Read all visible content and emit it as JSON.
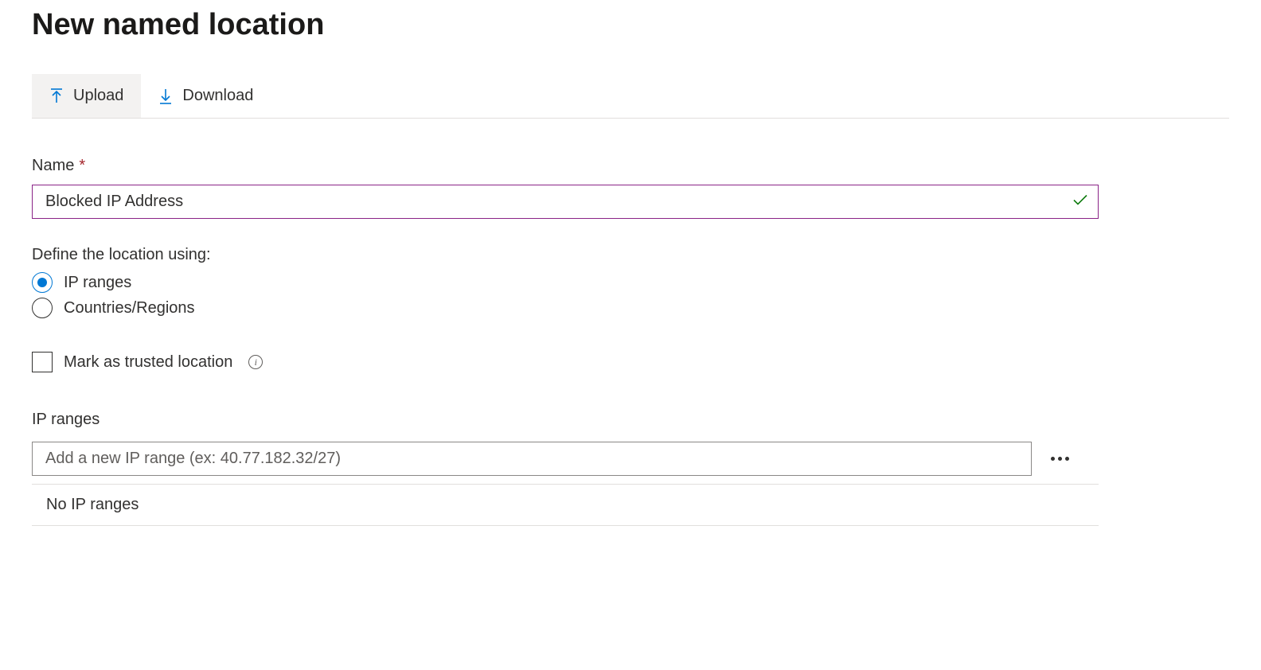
{
  "title": "New named location",
  "toolbar": {
    "upload_label": "Upload",
    "download_label": "Download"
  },
  "name_field": {
    "label": "Name",
    "required_mark": "*",
    "value": "Blocked IP Address"
  },
  "define": {
    "label": "Define the location using:",
    "option_ip": "IP ranges",
    "option_countries": "Countries/Regions",
    "selected": "ip"
  },
  "trusted": {
    "label": "Mark as trusted location",
    "checked": false
  },
  "ip_ranges": {
    "title": "IP ranges",
    "placeholder": "Add a new IP range (ex: 40.77.182.32/27)",
    "empty_text": "No IP ranges"
  }
}
